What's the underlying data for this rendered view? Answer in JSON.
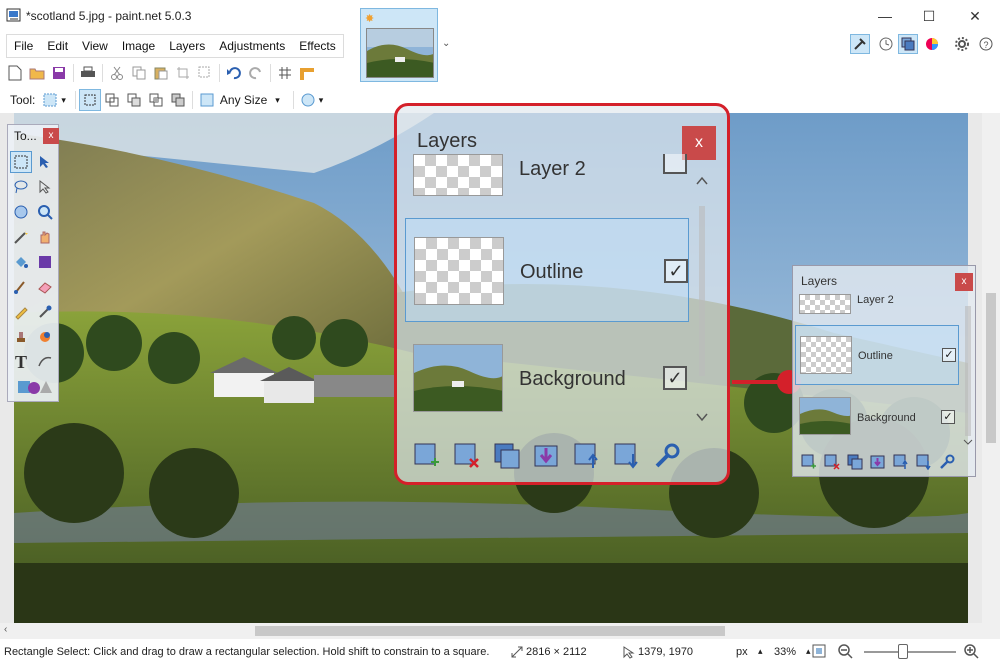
{
  "window": {
    "title": "*scotland 5.jpg - paint.net 5.0.3",
    "minimize": "—",
    "maximize": "☐",
    "close": "✕"
  },
  "menu": {
    "items": [
      "File",
      "Edit",
      "View",
      "Image",
      "Layers",
      "Adjustments",
      "Effects"
    ]
  },
  "toolbar": {
    "tool_label": "Tool:",
    "size_label": "Any Size"
  },
  "tools_window": {
    "title": "To...",
    "close": "x",
    "text_tool_glyph": "T"
  },
  "layers_big": {
    "title": "Layers",
    "close": "x",
    "layers": [
      {
        "name": "Layer 2",
        "visible": true
      },
      {
        "name": "Outline",
        "visible": true,
        "selected": true
      },
      {
        "name": "Background",
        "visible": true
      }
    ],
    "check_glyph": "✓"
  },
  "layers_small": {
    "title": "Layers",
    "close": "x",
    "layers": [
      {
        "name": "Layer 2"
      },
      {
        "name": "Outline"
      },
      {
        "name": "Background"
      }
    ]
  },
  "status": {
    "hint": "Rectangle Select: Click and drag to draw a rectangular selection. Hold shift to constrain to a square.",
    "image_size": "2816 × 2112",
    "cursor_pos": "1379, 1970",
    "unit": "px",
    "zoom": "33%"
  },
  "colors": {
    "accent_red": "#d4202a",
    "close_red": "#c94a4a",
    "selection_blue": "#5a9ad0"
  }
}
